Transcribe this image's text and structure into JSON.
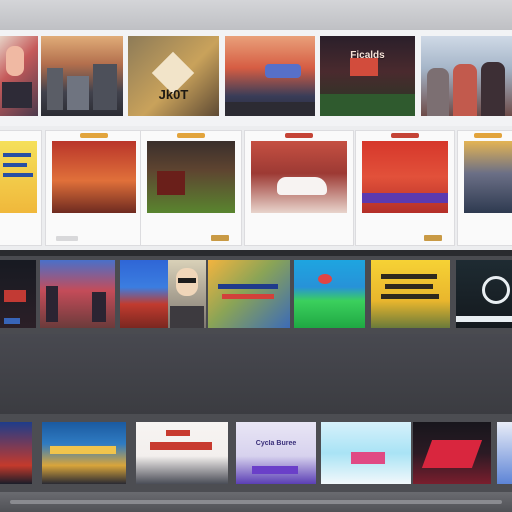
{
  "row1": {
    "tiles": [
      {
        "name": "tile-portrait-graphic",
        "caption": ""
      },
      {
        "name": "tile-skyline-sunset",
        "caption": ""
      },
      {
        "name": "tile-logo-poster",
        "caption": "Jk0T"
      },
      {
        "name": "tile-city-panorama",
        "caption": ""
      },
      {
        "name": "tile-night-title",
        "caption": "Ficalds"
      },
      {
        "name": "tile-group-photo",
        "caption": ""
      }
    ]
  },
  "row2": {
    "cards": [
      {
        "name": "card-yellow-promo",
        "caption": ""
      },
      {
        "name": "card-red-glow",
        "caption": ""
      },
      {
        "name": "card-storefront",
        "caption": ""
      },
      {
        "name": "card-car",
        "caption": ""
      },
      {
        "name": "card-stage",
        "caption": ""
      },
      {
        "name": "card-crowd",
        "caption": ""
      }
    ]
  },
  "row3": {
    "tiles": [
      {
        "name": "tile-dark-poster",
        "caption": ""
      },
      {
        "name": "tile-street",
        "caption": ""
      },
      {
        "name": "tile-sky-red",
        "caption": ""
      },
      {
        "name": "tile-face-illustration",
        "caption": ""
      },
      {
        "name": "tile-colorful-text",
        "caption": ""
      },
      {
        "name": "tile-green-hill",
        "caption": ""
      },
      {
        "name": "tile-yellow-title",
        "caption": ""
      },
      {
        "name": "tile-logo-dark",
        "caption": ""
      }
    ]
  },
  "row4": {
    "tiles": [
      {
        "name": "tile-edge-blue",
        "caption": ""
      },
      {
        "name": "tile-gold-title",
        "caption": ""
      },
      {
        "name": "tile-white-red-banner",
        "caption": ""
      },
      {
        "name": "tile-purple-card",
        "caption": "Cycla Buree"
      },
      {
        "name": "tile-cyan-card",
        "caption": ""
      },
      {
        "name": "tile-neon-red",
        "caption": ""
      },
      {
        "name": "tile-edge-right",
        "caption": ""
      }
    ]
  }
}
